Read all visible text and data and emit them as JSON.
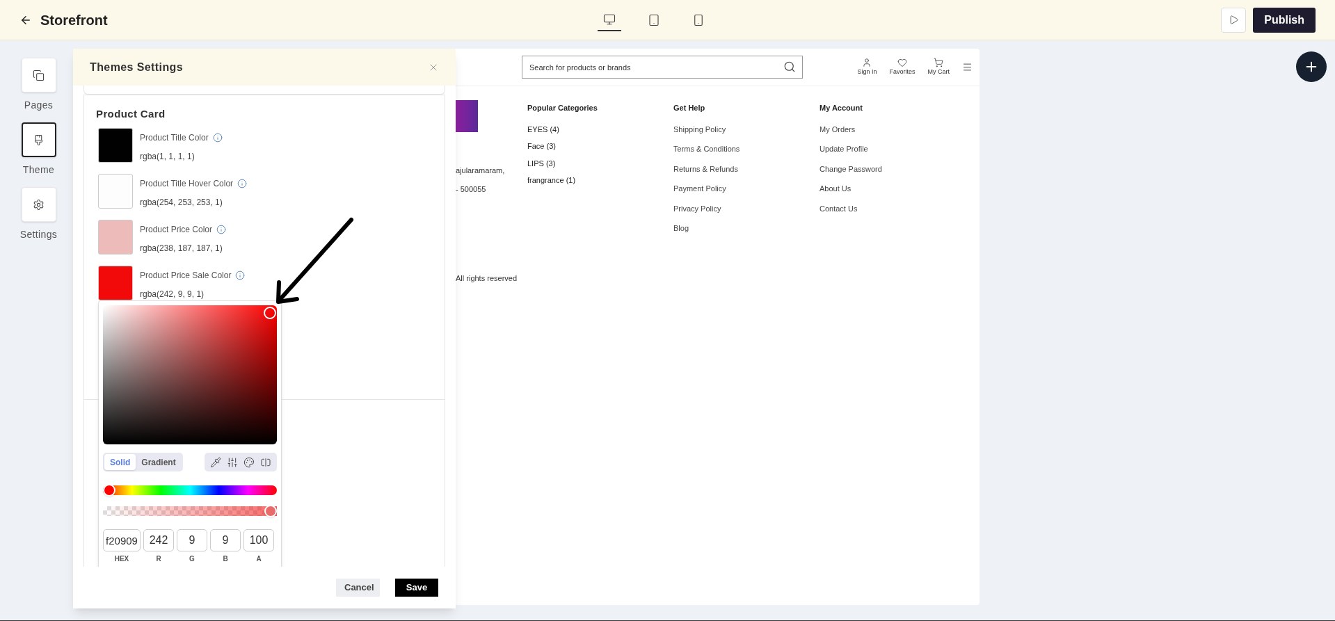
{
  "app_bar": {
    "title": "Storefront",
    "devices": [
      {
        "kind": "desktop",
        "selected": true
      },
      {
        "kind": "tablet",
        "selected": false
      },
      {
        "kind": "mobile",
        "selected": false
      }
    ],
    "publish": "Publish"
  },
  "sidebar": [
    {
      "kind": "pages",
      "label": "Pages",
      "selected": false
    },
    {
      "kind": "theme",
      "label": "Theme",
      "selected": true
    },
    {
      "kind": "settings",
      "label": "Settings",
      "selected": false
    }
  ],
  "panel": {
    "title": "Themes Settings",
    "section": "Product Card",
    "colors": [
      {
        "label": "Product Title Color",
        "value": "rgba(1, 1, 1, 1)",
        "color": "#010101"
      },
      {
        "label": "Product Title Hover Color",
        "value": "rgba(254, 253, 253, 1)",
        "color": "#fefdfd"
      },
      {
        "label": "Product Price Color",
        "value": "rgba(238, 187, 187, 1)",
        "color": "#eebbbb"
      },
      {
        "label": "Product Price Sale Color",
        "value": "rgba(242, 9, 9, 1)",
        "color": "#f20909"
      }
    ],
    "picker": {
      "modes": [
        {
          "label": "Solid",
          "selected": true
        },
        {
          "label": "Gradient",
          "selected": false
        }
      ],
      "hue": {
        "level": 0
      },
      "alpha": {
        "level": 1
      },
      "fields": [
        {
          "label": "HEX",
          "value": "f20909"
        },
        {
          "label": "R",
          "value": "242"
        },
        {
          "label": "G",
          "value": "9"
        },
        {
          "label": "B",
          "value": "9"
        },
        {
          "label": "A",
          "value": "100"
        }
      ]
    },
    "buttons": [
      {
        "kind": "secondary",
        "label": "Cancel"
      },
      {
        "kind": "primary",
        "label": "Save"
      }
    ]
  },
  "preview": {
    "search": {
      "placeholder": "Search for products or brands"
    },
    "header_links": [
      {
        "kind": "user",
        "label": "Sign In"
      },
      {
        "kind": "heart",
        "label": "Favorites"
      },
      {
        "kind": "cart",
        "label": "My Cart"
      }
    ],
    "address_lines": [
      "ajularamaram,",
      "- 500055"
    ],
    "columns": [
      {
        "title": "Popular Categories",
        "items": [
          "EYES (4)",
          "Face (3)",
          "LIPS (3)",
          "frangrance (1)"
        ]
      },
      {
        "title": "Get Help",
        "items": [
          "Shipping Policy",
          "Terms & Conditions",
          "Returns & Refunds",
          "Payment Policy",
          "Privacy Policy",
          "Blog"
        ]
      },
      {
        "title": "My Account",
        "items": [
          "My Orders",
          "Update Profile",
          "Change Password",
          "About Us",
          "Contact Us"
        ]
      }
    ],
    "copyright": "All rights reserved"
  }
}
